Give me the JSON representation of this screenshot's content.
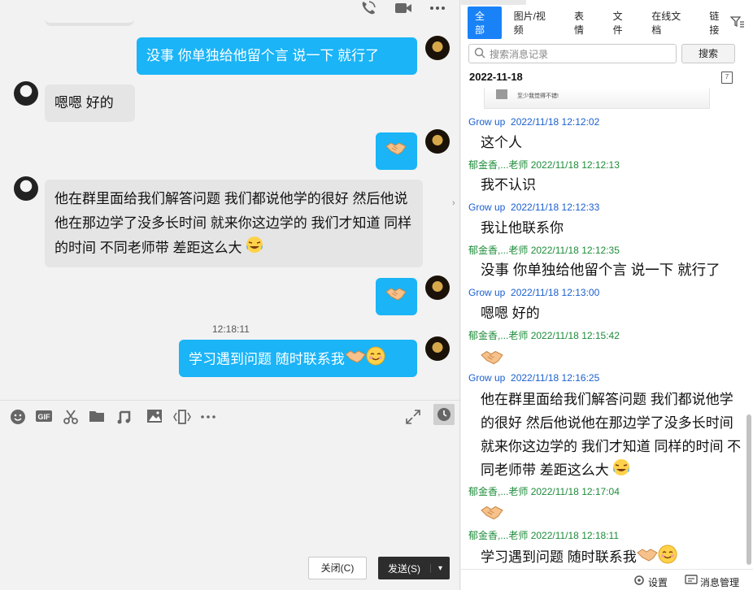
{
  "chat": {
    "messages": [
      {
        "side": "me",
        "text": "没事 你单独给他留个言 说一下 就行了"
      },
      {
        "side": "them",
        "text": "嗯嗯  好的"
      },
      {
        "side": "me",
        "emoji": "handshake"
      },
      {
        "side": "them",
        "text": "他在群里面给我们解答问题  我们都说他学的很好  然后他说他在那边学了没多长时间  就来你这边学的  我们才知道  同样的时间  不同老师带 差距这么大",
        "emoji": "tears-of-joy"
      },
      {
        "side": "me",
        "emoji": "handshake"
      },
      {
        "side": "me",
        "text": "学习遇到问题 随时联系我",
        "emoji": "handshake smile"
      }
    ],
    "time_divider": "12:18:11",
    "close_label": "关闭(C)",
    "send_label": "发送(S)"
  },
  "history": {
    "filters": [
      "全部",
      "图片/视频",
      "表情",
      "文件",
      "在线文档",
      "链接"
    ],
    "active_filter": "全部",
    "search_placeholder": "搜索消息记录",
    "search_button": "搜索",
    "date": "2022-11-18",
    "calendar_glyph": "7",
    "preview_caption": "至少我觉得不错!",
    "entries": [
      {
        "sender": "Grow up",
        "time": "2022/11/18 12:12:02",
        "text": "这个人"
      },
      {
        "sender": "郁金香,...老师",
        "time": "2022/11/18 12:12:13",
        "text": "我不认识"
      },
      {
        "sender": "Grow up",
        "time": "2022/11/18 12:12:33",
        "text": "我让他联系你"
      },
      {
        "sender": "郁金香,...老师",
        "time": "2022/11/18 12:12:35",
        "text": "没事 你单独给他留个言 说一下 就行了"
      },
      {
        "sender": "Grow up",
        "time": "2022/11/18 12:13:00",
        "text": "嗯嗯  好的"
      },
      {
        "sender": "郁金香,...老师",
        "time": "2022/11/18 12:15:42",
        "emoji": "handshake"
      },
      {
        "sender": "Grow up",
        "time": "2022/11/18 12:16:25",
        "text": "他在群里面给我们解答问题  我们都说他学的很好  然后他说他在那边学了没多长时间  就来你这边学的  我们才知道  同样的时间  不同老师带 差距这么大"
      },
      {
        "sender": "郁金香,...老师",
        "time": "2022/11/18 12:17:04",
        "emoji": "handshake"
      },
      {
        "sender": "郁金香,...老师",
        "time": "2022/11/18 12:18:11",
        "text": "学习遇到问题 随时联系我"
      }
    ],
    "settings_label": "设置",
    "manage_label": "消息管理"
  }
}
